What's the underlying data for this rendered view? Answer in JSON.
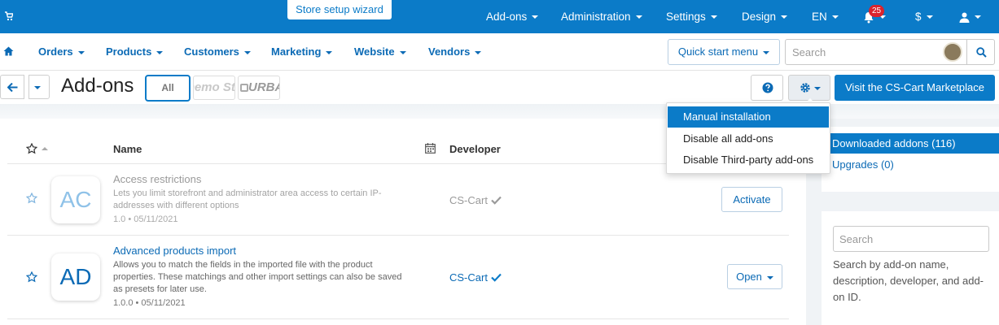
{
  "topbar": {
    "wizard_label": "Store setup wizard",
    "nav": [
      {
        "label": "Add-ons"
      },
      {
        "label": "Administration"
      },
      {
        "label": "Settings"
      },
      {
        "label": "Design"
      },
      {
        "label": "EN"
      }
    ],
    "notifications_count": "25",
    "currency_label": "$"
  },
  "navbar2": {
    "items": [
      {
        "label": "Orders"
      },
      {
        "label": "Products"
      },
      {
        "label": "Customers"
      },
      {
        "label": "Marketing"
      },
      {
        "label": "Website"
      },
      {
        "label": "Vendors"
      }
    ],
    "quick_start_label": "Quick start menu",
    "search_placeholder": "Search"
  },
  "titlebar": {
    "title": "Add-ons",
    "filter_all_label": "All",
    "filter_logos": [
      "Demo Store",
      "URBAN"
    ],
    "marketplace_label": "Visit the CS-Cart Marketplace"
  },
  "gear_menu": {
    "items": [
      {
        "label": "Manual installation",
        "active": true
      },
      {
        "label": "Disable all add-ons",
        "active": false
      },
      {
        "label": "Disable Third-party add-ons",
        "active": false
      }
    ]
  },
  "table": {
    "headers": {
      "name": "Name",
      "developer": "Developer"
    },
    "rows": [
      {
        "logo_text": "AC",
        "name": "Access restrictions",
        "description": "Lets you limit storefront and administrator area access to certain IP-addresses with different options",
        "version": "1.0 • 05/11/2021",
        "developer": "CS-Cart",
        "action": "Activate",
        "installed": false
      },
      {
        "logo_text": "AD",
        "name": "Advanced products import",
        "description": "Allows you to match the fields in the imported file with the product properties. These matchings and other import settings can also be saved as presets for later use.",
        "version": "1.0.0 • 05/11/2021",
        "developer": "CS-Cart",
        "action": "Open",
        "installed": true
      }
    ]
  },
  "sidebar": {
    "active_item": "Downloaded addons (116)",
    "link_item": "Upgrades (0)",
    "search_placeholder": "Search",
    "search_hint": "Search by add-on name, description, developer, and add-on ID."
  },
  "colors": {
    "primary": "#0b7bc8",
    "link": "#0b6ab5",
    "badge": "#d9232d",
    "muted": "#9a9a9a"
  },
  "icons": [
    "cart-icon",
    "bell-icon",
    "user-icon",
    "home-icon",
    "search-icon",
    "arrow-left-icon",
    "question-icon",
    "gear-icon",
    "star-outline-icon",
    "calendar-icon",
    "check-icon"
  ]
}
